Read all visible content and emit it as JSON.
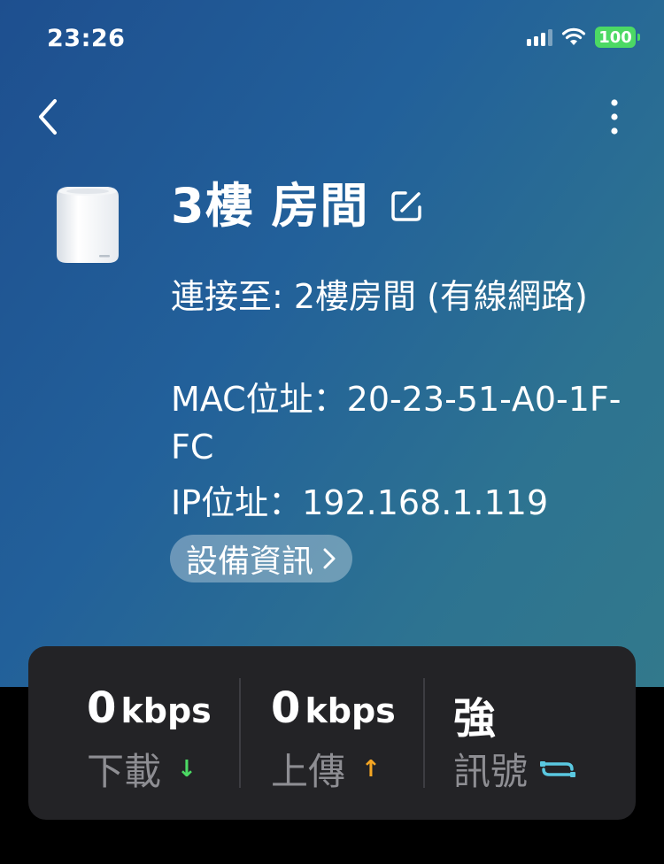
{
  "status_bar": {
    "time": "23:26",
    "battery": "100"
  },
  "device": {
    "name": "3樓 房間",
    "connection": "連接至: 2樓房間 (有線網路)",
    "mac": "MAC位址：20-23-51-A0-1F-FC",
    "ip": "IP位址：192.168.1.119",
    "info_button": "設備資訊"
  },
  "stats": {
    "download": {
      "value": "0",
      "unit": "kbps",
      "label": "下載",
      "arrow": "↓",
      "color": "#4cd964"
    },
    "upload": {
      "value": "0",
      "unit": "kbps",
      "label": "上傳",
      "arrow": "↑",
      "color": "#f5a623"
    },
    "signal": {
      "value": "強",
      "label": "訊號",
      "icon": "ethernet-link-icon",
      "color": "#5ac8e0"
    }
  },
  "colors": {
    "accent_blue": "#1e4f8f",
    "card_bg": "#232326"
  }
}
